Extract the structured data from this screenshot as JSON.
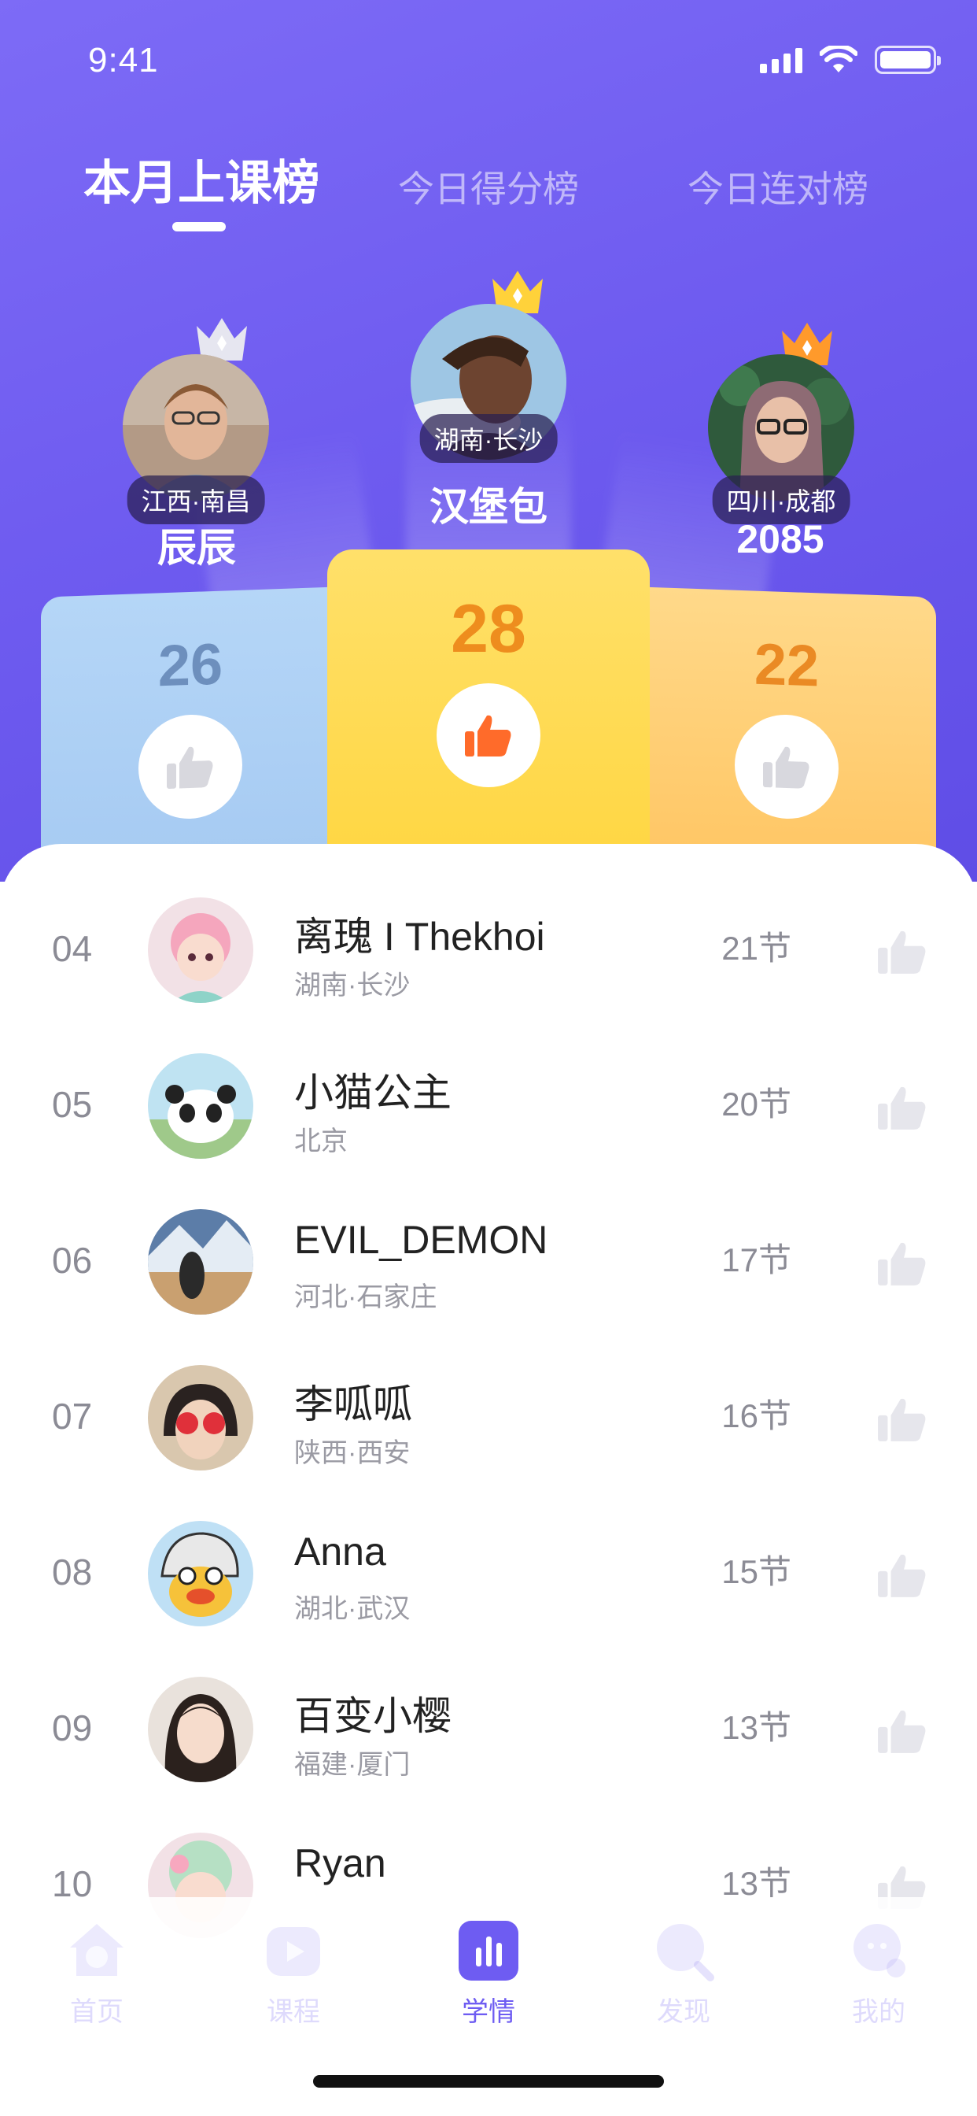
{
  "status_bar": {
    "time": "9:41"
  },
  "tabs": [
    {
      "label": "本月上课榜",
      "active": true
    },
    {
      "label": "今日得分榜",
      "active": false
    },
    {
      "label": "今日连对榜",
      "active": false
    }
  ],
  "podium": {
    "first": {
      "name": "汉堡包",
      "location": "湖南·长沙",
      "score": "28",
      "crown_color": "#ffd23a"
    },
    "second": {
      "name": "辰辰",
      "location": "江西·南昌",
      "score": "26",
      "crown_color": "#e6e6f0"
    },
    "third": {
      "name": "2085",
      "location": "四川·成都",
      "score": "22",
      "crown_color": "#ff9a2b"
    }
  },
  "ranking": [
    {
      "rank": "04",
      "name": "离瑰 I Thekhoi",
      "location": "湖南·长沙",
      "count": "21节"
    },
    {
      "rank": "05",
      "name": "小猫公主",
      "location": "北京",
      "count": "20节"
    },
    {
      "rank": "06",
      "name": "EVIL_DEMON",
      "location": "河北·石家庄",
      "count": "17节"
    },
    {
      "rank": "07",
      "name": "李呱呱",
      "location": "陕西·西安",
      "count": "16节"
    },
    {
      "rank": "08",
      "name": "Anna",
      "location": "湖北·武汉",
      "count": "15节"
    },
    {
      "rank": "09",
      "name": "百变小樱",
      "location": "福建·厦门",
      "count": "13节"
    },
    {
      "rank": "10",
      "name": "Ryan",
      "location": "",
      "count": "13节"
    }
  ],
  "nav": [
    {
      "label": "首页",
      "icon": "home-icon"
    },
    {
      "label": "课程",
      "icon": "course-play-icon"
    },
    {
      "label": "学情",
      "icon": "stats-bar-icon",
      "active": true
    },
    {
      "label": "发现",
      "icon": "discover-search-icon"
    },
    {
      "label": "我的",
      "icon": "profile-icon"
    }
  ],
  "colors": {
    "accent": "#6e5cf2",
    "gold": "#ffd23a",
    "orange": "#ff8a2a",
    "blue_block": "#a9cdf5"
  }
}
